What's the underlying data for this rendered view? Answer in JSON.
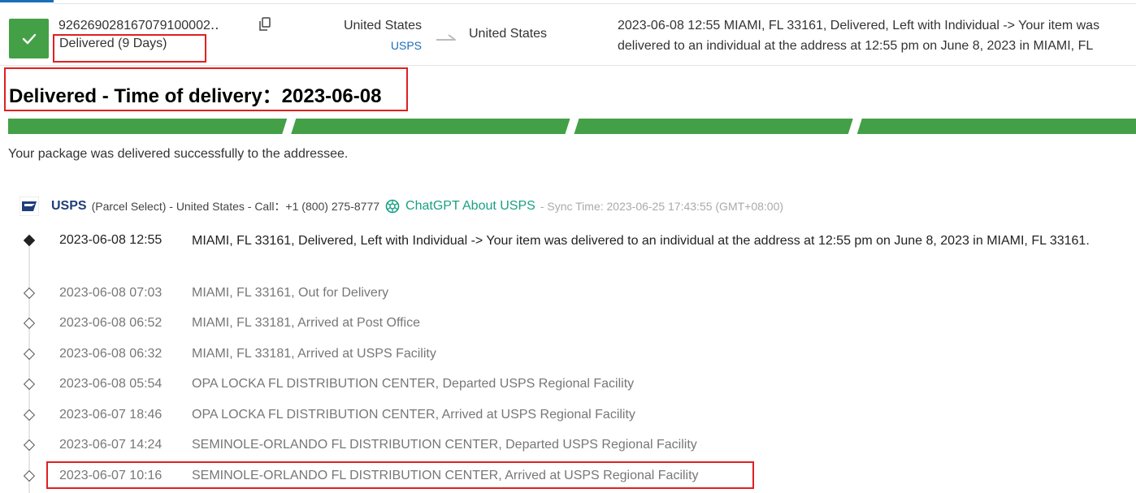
{
  "summary": {
    "tracking_number": "926269028167079100002‥",
    "status_text": "Delivered (9 Days)",
    "origin_country": "United States",
    "carrier_link": "USPS",
    "destination_country": "United States",
    "latest_event": "2023-06-08 12:55  MIAMI, FL 33161, Delivered, Left with Individual -> Your item was delivered to an individual at the address at 12:55 pm on June 8, 2023 in MIAMI, FL 33161."
  },
  "status": {
    "title": "Delivered - Time of delivery：2023-06-08",
    "progress_fraction": 1.0,
    "progress_segments": 4,
    "progress_color": "#43a047",
    "message": "Your package was delivered successfully to the addressee."
  },
  "carrier": {
    "name": "USPS",
    "meta": "(Parcel Select) - United States - Call：+1 (800) 275-8777",
    "chatgpt_label": "ChatGPT About USPS",
    "sync_time": "- Sync Time: 2023-06-25 17:43:55 (GMT+08:00)"
  },
  "events": [
    {
      "time": "2023-06-08 12:55",
      "desc": "MIAMI, FL 33161, Delivered, Left with Individual -> Your item was delivered to an individual at the address at 12:55 pm on June 8, 2023 in MIAMI, FL 33161."
    },
    {
      "time": "2023-06-08 07:03",
      "desc": "MIAMI, FL 33161, Out for Delivery"
    },
    {
      "time": "2023-06-08 06:52",
      "desc": "MIAMI, FL 33181, Arrived at Post Office"
    },
    {
      "time": "2023-06-08 06:32",
      "desc": "MIAMI, FL 33181, Arrived at USPS Facility"
    },
    {
      "time": "2023-06-08 05:54",
      "desc": "OPA LOCKA FL DISTRIBUTION CENTER, Departed USPS Regional Facility"
    },
    {
      "time": "2023-06-07 18:46",
      "desc": "OPA LOCKA FL DISTRIBUTION CENTER, Arrived at USPS Regional Facility"
    },
    {
      "time": "2023-06-07 14:24",
      "desc": "SEMINOLE-ORLANDO FL DISTRIBUTION CENTER, Departed USPS Regional Facility"
    },
    {
      "time": "2023-06-07 10:16",
      "desc": "SEMINOLE-ORLANDO FL DISTRIBUTION CENTER, Arrived at USPS Regional Facility"
    }
  ],
  "colors": {
    "accent_green": "#43a047",
    "link_blue": "#1a6fb8",
    "highlight_red": "#e02020",
    "chatgpt_green": "#19a083"
  },
  "icons": {
    "status": "checkmark-icon",
    "copy": "copy-icon",
    "route": "arrow-right-icon",
    "carrier": "usps-logo-icon",
    "chatgpt": "chatgpt-icon",
    "timeline": "diamond-icon"
  }
}
